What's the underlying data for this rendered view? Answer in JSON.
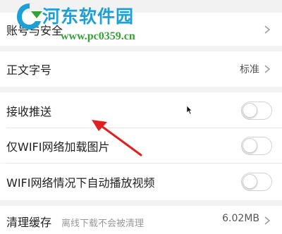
{
  "watermark": {
    "title": "河东软件园",
    "url": "www.pc0359.cn"
  },
  "settings": {
    "account_security": {
      "label": "账号与安全"
    },
    "font_size": {
      "label": "正文字号",
      "value": "标准"
    },
    "push": {
      "label": "接收推送",
      "enabled": false
    },
    "wifi_images": {
      "label": "仅WIFI网络加载图片",
      "enabled": false
    },
    "wifi_autoplay": {
      "label": "WIFI网络情况下自动播放视频",
      "enabled": false
    },
    "clear_cache": {
      "label": "清理缓存",
      "hint": "离线下载不会被清理",
      "value": "6.02MB"
    }
  },
  "icons": [
    "chevron-right-icon",
    "red-arrow-annotation",
    "mouse-cursor-icon",
    "watermark-logo"
  ],
  "colors": {
    "background": "#f2f2f2",
    "row": "#ffffff",
    "annotation_arrow": "#e02020",
    "watermark_blue": "#1e9fd6",
    "watermark_green": "#3aa13a"
  }
}
